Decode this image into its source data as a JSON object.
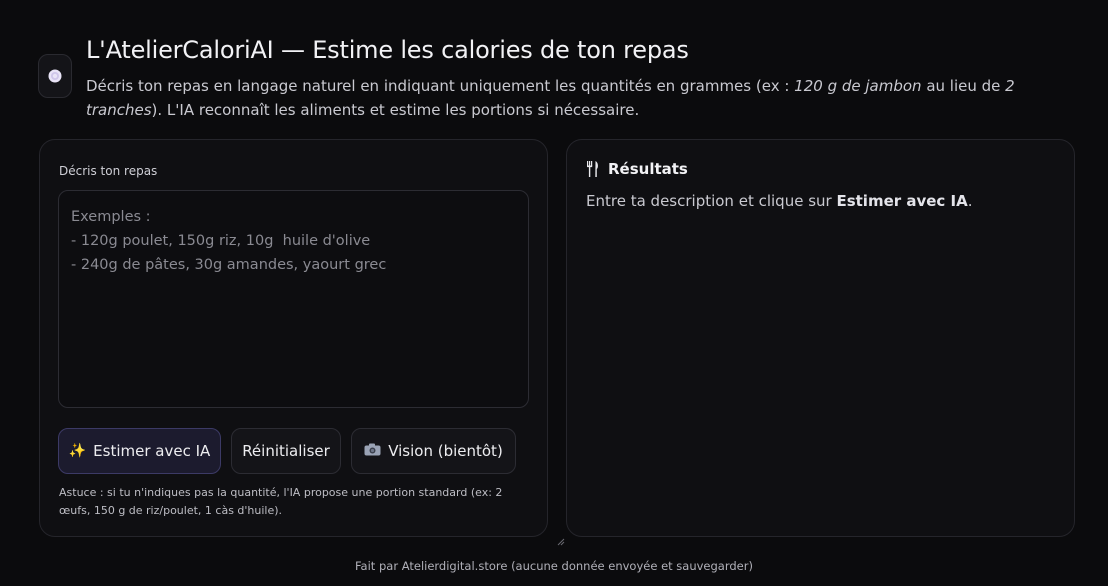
{
  "header": {
    "logo_icon": "plate-icon",
    "title": "L'AtelierCaloriAI — Estime les calories de ton repas",
    "subtitle": {
      "part1": "Décris ton repas en langage naturel en indiquant uniquement les quantités en grammes (ex : ",
      "example1": "120 g de jambon",
      "part2": " au lieu de ",
      "example2": "2 tranches",
      "part3": "). L'IA reconnaît les aliments et estime les portions si nécessaire."
    }
  },
  "input_panel": {
    "label": "Décris ton repas",
    "textarea_value": "",
    "textarea_placeholder": "Exemples :\n- 120g poulet, 150g riz, 10g  huile d'olive\n- 240g de pâtes, 30g amandes, yaourt grec",
    "buttons": {
      "estimate": {
        "label": "Estimer avec IA",
        "icon": "sparkles-icon"
      },
      "reset": {
        "label": "Réinitialiser"
      },
      "vision": {
        "label": "Vision (bientôt)",
        "icon": "camera-icon"
      }
    },
    "tip": "Astuce : si tu n'indiques pas la quantité, l'IA propose une portion standard (ex: 2 œufs, 150 g de riz/poulet, 1 càs d'huile)."
  },
  "results_panel": {
    "icon": "fork-knife-icon",
    "title": "Résultats",
    "empty_text_before": "Entre ta description et clique sur ",
    "empty_text_bold": "Estimer avec IA",
    "empty_text_after": "."
  },
  "footer": {
    "text": "Fait par Atelierdigital.store (aucune donnée envoyée et sauvegarder)"
  },
  "colors": {
    "background": "#0b0b0d",
    "panel": "#0f0f12",
    "primary_button": "#1c1b2e",
    "primary_border": "#3c3a66"
  }
}
